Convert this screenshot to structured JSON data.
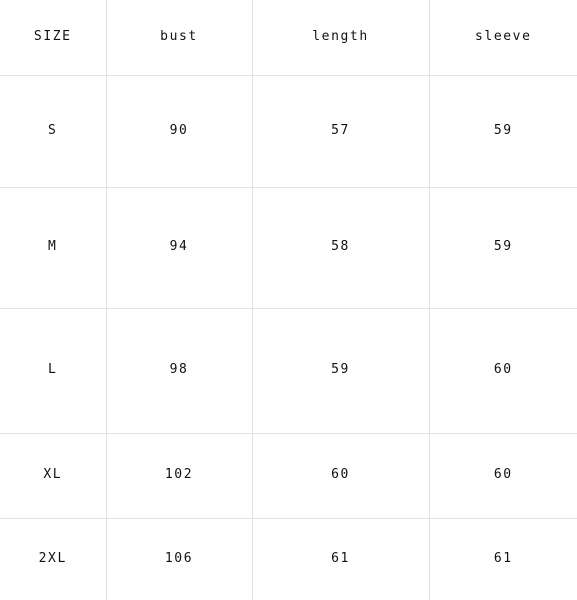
{
  "table": {
    "name": "size-chart",
    "headers": [
      "SIZE",
      "bust",
      "length",
      "sleeve"
    ],
    "rows": [
      {
        "size": "S",
        "bust": "90",
        "length": "57",
        "sleeve": "59"
      },
      {
        "size": "M",
        "bust": "94",
        "length": "58",
        "sleeve": "59"
      },
      {
        "size": "L",
        "bust": "98",
        "length": "59",
        "sleeve": "60"
      },
      {
        "size": "XL",
        "bust": "102",
        "length": "60",
        "sleeve": "60"
      },
      {
        "size": "2XL",
        "bust": "106",
        "length": "61",
        "sleeve": "61"
      }
    ],
    "colors": {
      "background": "#ffffff",
      "gridline": "#e2e2e2",
      "text": "#111111"
    }
  }
}
